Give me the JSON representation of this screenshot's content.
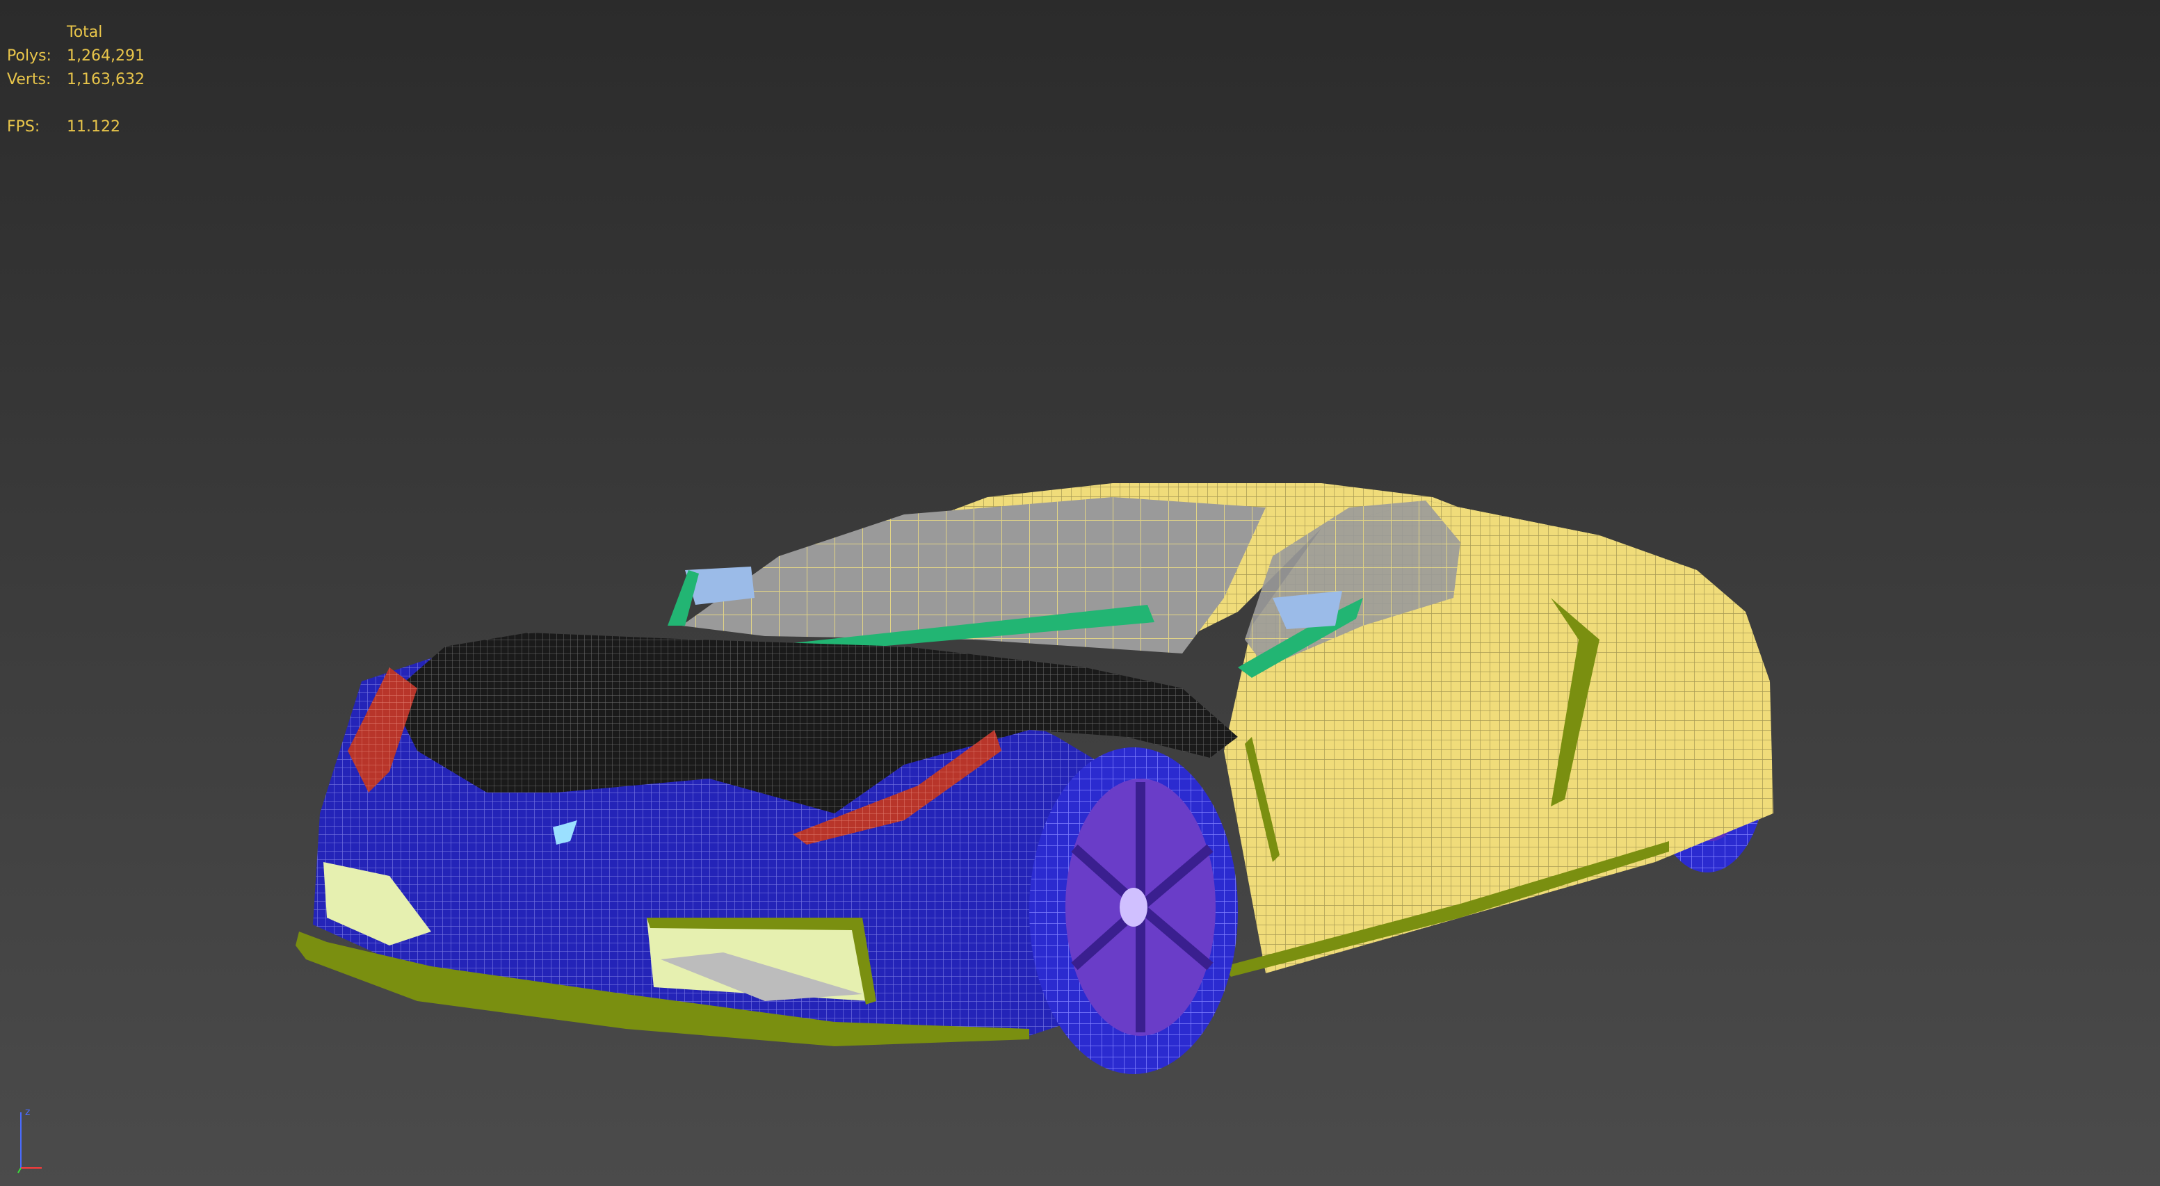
{
  "stats": {
    "header": "Total",
    "polys_label": "Polys:",
    "polys_value": "1,264,291",
    "verts_label": "Verts:",
    "verts_value": "1,163,632",
    "fps_label": "FPS:",
    "fps_value": "11.122"
  },
  "axis": {
    "z_label": "z"
  },
  "colors": {
    "stats_text": "#e8c54a",
    "body_yellow": "#f0dc7a",
    "front_blue": "#1f1fb0",
    "hood_black": "#1c1c1c",
    "trim_green": "#7a8f10",
    "glass_gray": "#9a9a9a",
    "light_red": "#c0392b",
    "wiper_green": "#22b573",
    "mirror_blue": "#9bbbe8"
  }
}
